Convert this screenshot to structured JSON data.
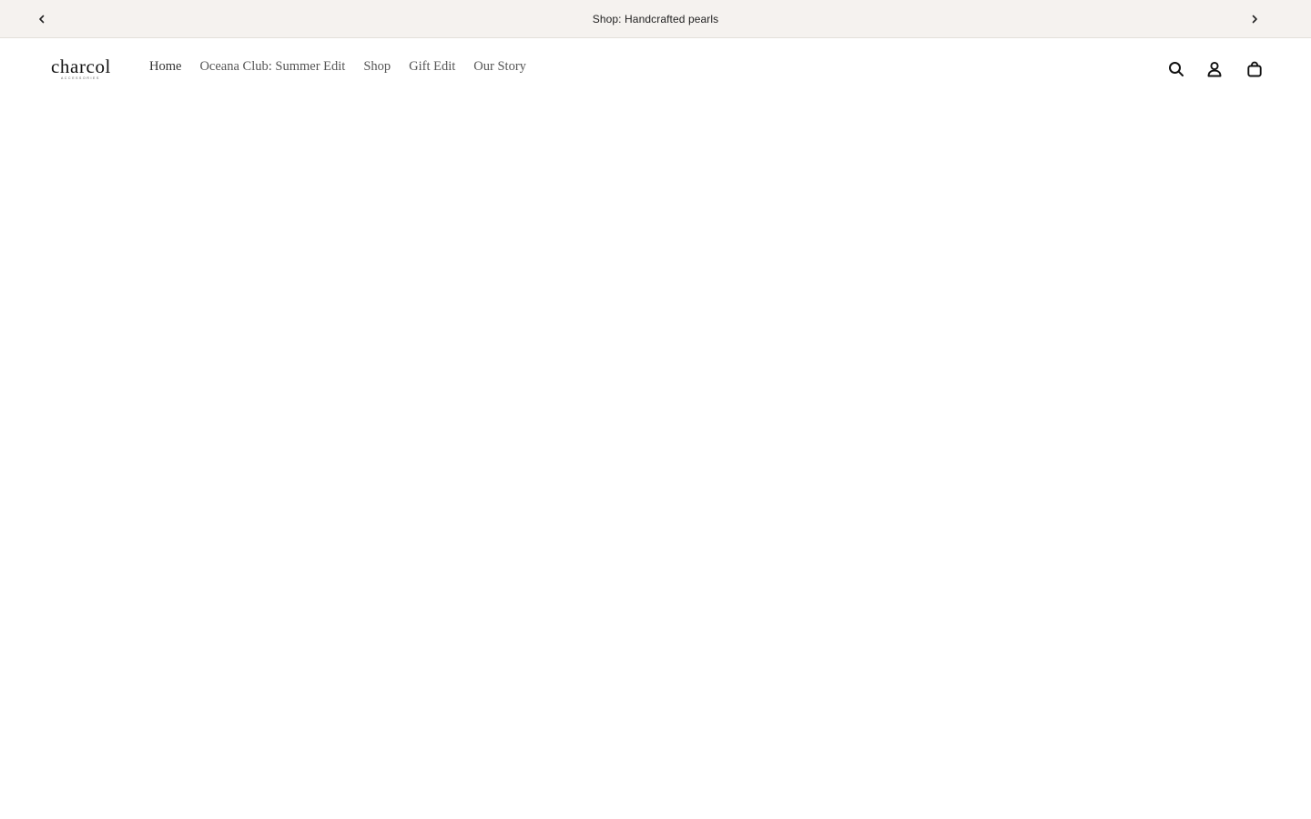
{
  "announcement": {
    "text": "Shop: Handcrafted pearls",
    "prev_icon": "chevron-left-icon",
    "next_icon": "chevron-right-icon"
  },
  "header": {
    "logo": {
      "name": "charcol",
      "tagline": "ACCESSORIES"
    },
    "nav": {
      "home": "Home",
      "oceana": "Oceana Club: Summer Edit",
      "shop": "Shop",
      "gift": "Gift Edit",
      "story": "Our Story"
    },
    "icons": {
      "search": "search-icon",
      "account": "user-icon",
      "cart": "shopping-bag-icon"
    }
  },
  "colors": {
    "announcement_bg": "#f5f2ef",
    "text_primary": "#222222",
    "nav_text": "#555555",
    "background": "#ffffff"
  }
}
